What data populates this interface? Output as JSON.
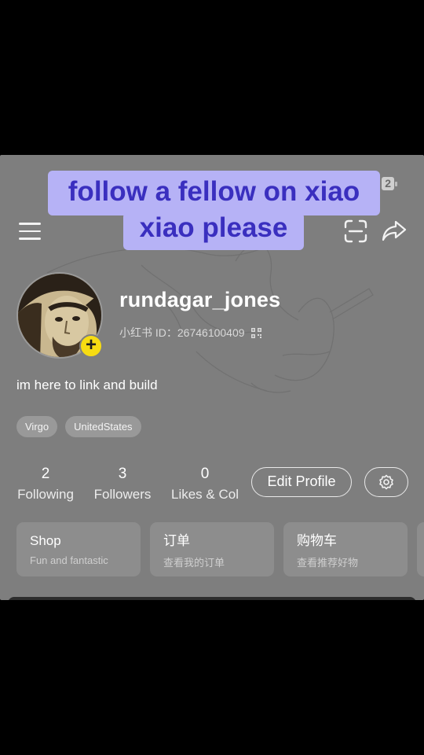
{
  "status": {
    "badge": "2"
  },
  "profile": {
    "username": "rundagar_jones",
    "id_label": "小红书 ID：26746100409",
    "bio": "im here to link and build",
    "tags": [
      "Virgo",
      "UnitedStates"
    ]
  },
  "stats": [
    {
      "value": "2",
      "label": "Following"
    },
    {
      "value": "3",
      "label": "Followers"
    },
    {
      "value": "0",
      "label": "Likes & Col"
    }
  ],
  "actions": {
    "edit_profile": "Edit Profile"
  },
  "cards": [
    {
      "title": "Shop",
      "subtitle": "Fun and fantastic"
    },
    {
      "title": "订单",
      "subtitle": "查看我的订单"
    },
    {
      "title": "购物车",
      "subtitle": "查看推荐好物"
    }
  ],
  "caption": {
    "line1": "follow a fellow on xiao",
    "line2": "xiao please"
  },
  "colors": {
    "screen_bg": "#7e7e7e",
    "caption_bg": "#b6b2f6",
    "caption_text": "#3a2fbf",
    "avatar_add": "#f7dc12"
  },
  "icons": [
    "menu-icon",
    "scan-icon",
    "share-icon",
    "qr-code-icon",
    "plus-icon",
    "settings-gear-icon"
  ]
}
